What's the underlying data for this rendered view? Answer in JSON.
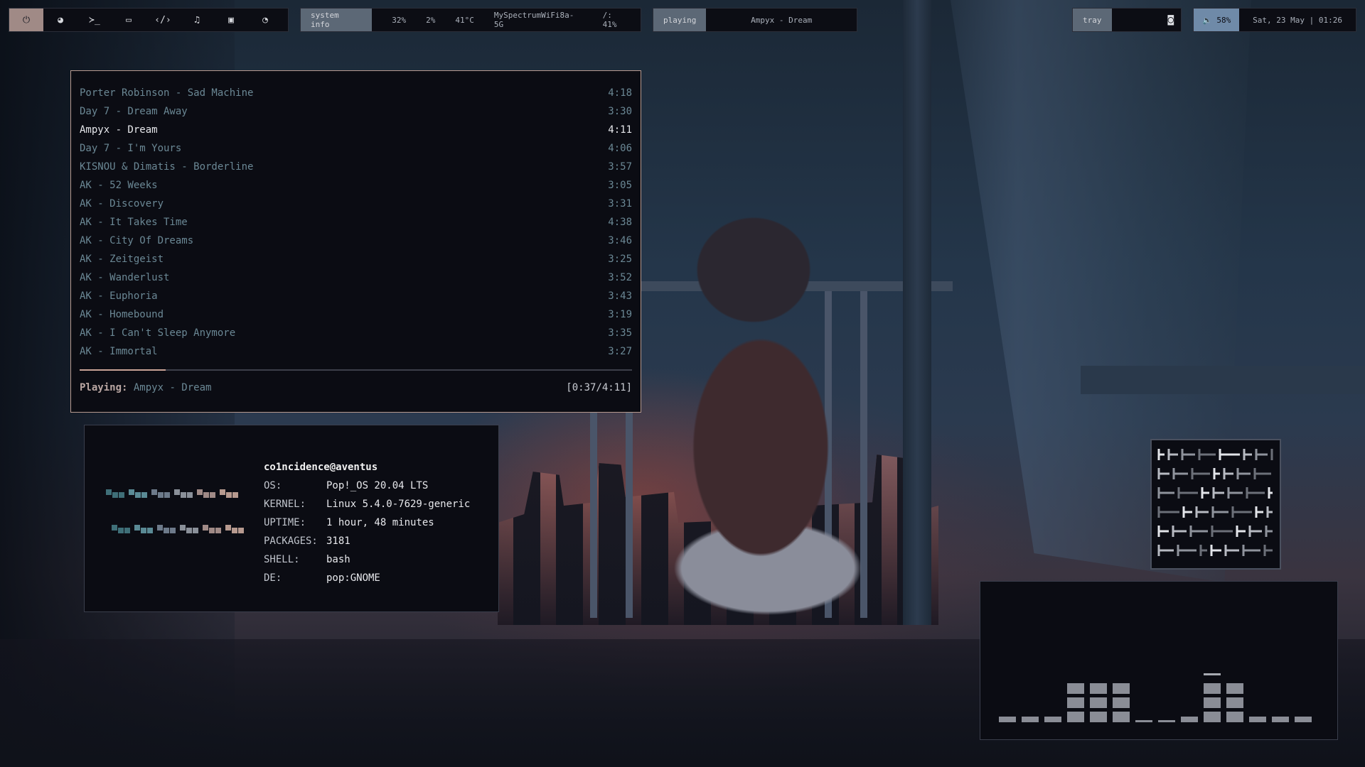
{
  "launcher": {
    "icons": [
      "power-icon",
      "browser-icon",
      "terminal-icon",
      "folder-icon",
      "code-icon",
      "music-icon",
      "chat-icon",
      "steam-icon"
    ],
    "glyphs": [
      "⏻",
      "◕",
      "≻_",
      "▭",
      "‹/›",
      "♫",
      "▣",
      "◔"
    ]
  },
  "sysinfo": {
    "tag": "system info",
    "cpu": "32%",
    "mem": "2%",
    "temp": "41°C",
    "wifi": "MySpectrumWiFi8a-5G",
    "disk": "/: 41%"
  },
  "player_bar": {
    "tag": "playing",
    "title": "Ampyx - Dream"
  },
  "tray": {
    "tag": "tray",
    "discord_glyph": "◙"
  },
  "clock": {
    "volume": "🔈 58%",
    "datetime": "Sat, 23 May | 01:26"
  },
  "music": {
    "tracks": [
      {
        "title": "Porter Robinson - Sad Machine",
        "duration": "4:18"
      },
      {
        "title": "Day 7 - Dream Away",
        "duration": "3:30"
      },
      {
        "title": "Ampyx - Dream",
        "duration": "4:11",
        "current": true
      },
      {
        "title": "Day 7 - I'm Yours",
        "duration": "4:06"
      },
      {
        "title": "KISNOU & Dimatis - Borderline",
        "duration": "3:57"
      },
      {
        "title": "AK - 52 Weeks",
        "duration": "3:05"
      },
      {
        "title": "AK - Discovery",
        "duration": "3:31"
      },
      {
        "title": "AK - It Takes Time",
        "duration": "4:38"
      },
      {
        "title": "AK - City Of Dreams",
        "duration": "3:46"
      },
      {
        "title": "AK - Zeitgeist",
        "duration": "3:25"
      },
      {
        "title": "AK - Wanderlust",
        "duration": "3:52"
      },
      {
        "title": "AK - Euphoria",
        "duration": "3:43"
      },
      {
        "title": "AK - Homebound",
        "duration": "3:19"
      },
      {
        "title": "AK - I Can't Sleep Anymore",
        "duration": "3:35"
      },
      {
        "title": "AK - Immortal",
        "duration": "3:27"
      }
    ],
    "progress_fraction": 0.156,
    "now_label": "Playing:",
    "now_title": "Ampyx - Dream",
    "time": "[0:37/4:11]"
  },
  "fetch": {
    "user": "co1ncidence@aventus",
    "rows": [
      {
        "key": "OS:",
        "value": "Pop!_OS 20.04 LTS"
      },
      {
        "key": "KERNEL:",
        "value": "Linux 5.4.0-7629-generic"
      },
      {
        "key": "UPTIME:",
        "value": "1 hour, 48 minutes"
      },
      {
        "key": "PACKAGES:",
        "value": "3181"
      },
      {
        "key": "SHELL:",
        "value": "bash"
      },
      {
        "key": "DE:",
        "value": "pop:GNOME"
      }
    ],
    "palette": [
      "#3f6f78",
      "#5a8a95",
      "#6d7a8a",
      "#8a9099",
      "#a08a86",
      "#b79a8f"
    ]
  },
  "visualizer": {
    "levels": [
      1,
      1,
      1,
      4,
      4,
      4,
      0,
      0,
      1,
      5,
      4,
      1,
      1,
      1
    ],
    "color": "#8a8d96",
    "peak_color": "#a7aab2"
  }
}
